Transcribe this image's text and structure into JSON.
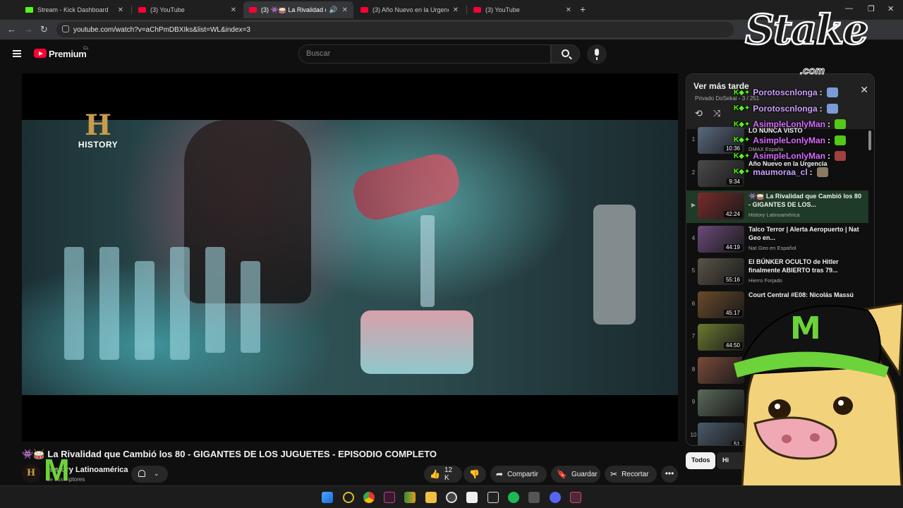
{
  "browser": {
    "tabs": [
      {
        "title": "Stream - Kick Dashboard",
        "kind": "kick",
        "active": false
      },
      {
        "title": "(3) YouTube",
        "kind": "yt",
        "active": false
      },
      {
        "title": "(3) 👾🥁 La Rivalidad que",
        "kind": "yt",
        "active": true
      },
      {
        "title": "(3) Año Nuevo en la Urgencia -",
        "kind": "yt",
        "active": false
      },
      {
        "title": "(3) YouTube",
        "kind": "yt",
        "active": false
      }
    ],
    "url": "youtube.com/watch?v=aChPmDBXIks&list=WL&index=3"
  },
  "youtube": {
    "brand": "Premium",
    "region": "CL",
    "search_placeholder": "Buscar"
  },
  "video": {
    "channel_logo_letter": "H",
    "channel_logo_text": "HISTORY",
    "title_emoji": "👾🥁",
    "title": "La Rivalidad que Cambió los 80 - GIGANTES DE LOS JUGUETES - EPISODIO COMPLETO",
    "channel": "History Latinoamérica",
    "subscribers": "de suscriptores",
    "likes": "12 K",
    "share": "Compartir",
    "save": "Guardar",
    "clip": "Recortar"
  },
  "playlist": {
    "title": "Ver más tarde",
    "meta": "Privado  DoSekai - 3 / 251",
    "items": [
      {
        "num": "1",
        "title": "LO NUNCA VISTO",
        "channel": "DMAX España",
        "duration": "10:36",
        "thumb": "#5a6a80"
      },
      {
        "num": "2",
        "title": "Año Nuevo en la Urgencia",
        "channel": "",
        "duration": "9:34",
        "thumb": "#4a4a4a"
      },
      {
        "num": "▶",
        "title": "👾🥁 La Rivalidad que Cambió los 80 - GIGANTES DE LOS...",
        "channel": "History Latinoamérica",
        "duration": "42:24",
        "thumb": "#7a2b2b"
      },
      {
        "num": "4",
        "title": "Talco Terror | Alerta Aeropuerto | Nat Geo en...",
        "channel": "Nat Geo en Español",
        "duration": "44:19",
        "thumb": "#6b4a7a"
      },
      {
        "num": "5",
        "title": "El BÚNKER OCULTO de Hitler finalmente ABIERTO tras 79...",
        "channel": "Hierro Forjado",
        "duration": "55:16",
        "thumb": "#5a5448"
      },
      {
        "num": "6",
        "title": "Court Central #E08: Nicolás Massú",
        "channel": "",
        "duration": "45:17",
        "thumb": "#6a4a2a"
      },
      {
        "num": "7",
        "title": "",
        "channel": "",
        "duration": "44:50",
        "thumb": "#6a7a30"
      },
      {
        "num": "8",
        "title": "",
        "channel": "",
        "duration": "",
        "thumb": "#7a4a3a"
      },
      {
        "num": "9",
        "title": "",
        "channel": "",
        "duration": "",
        "thumb": "#5a6a5a"
      },
      {
        "num": "10",
        "title": "",
        "channel": "",
        "duration": "51",
        "thumb": "#4a5a6a"
      }
    ],
    "chip_all": "Todos",
    "chip_other": "Hi"
  },
  "overlay": {
    "sponsor": "Stake",
    "sponsor_tld": ".com",
    "chat": [
      {
        "user": "Porotoscnlonga",
        "color": "#c9a0ff",
        "emote": "#7a9ad8"
      },
      {
        "user": "Porotoscnlonga",
        "color": "#c9a0ff",
        "emote": "#7a9ad8"
      },
      {
        "user": "AsimpleLonlyMan",
        "color": "#d86bff",
        "emote": "#53c818"
      },
      {
        "user": "AsimpleLonlyMan",
        "color": "#d86bff",
        "emote": "#53c818"
      },
      {
        "user": "AsimpleLonlyMan",
        "color": "#d86bff",
        "emote": "#a04040"
      },
      {
        "user": "maumoraa_cl",
        "color": "#c9a0ff",
        "emote": "#8a7a60"
      }
    ]
  }
}
